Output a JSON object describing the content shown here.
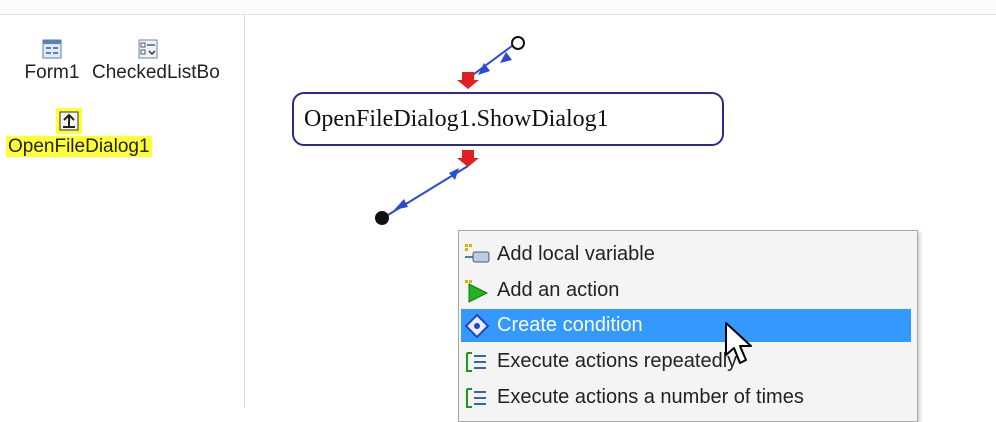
{
  "components": [
    {
      "label": "Form1",
      "icon": "form-icon"
    },
    {
      "label": "CheckedListBo",
      "icon": "checked-list-box-icon"
    },
    {
      "label": "OpenFileDialog1",
      "icon": "open-file-dialog-icon",
      "selected": true
    }
  ],
  "flow": {
    "node_label": "OpenFileDialog1.ShowDialog1"
  },
  "context_menu": {
    "items": [
      {
        "label": "Add local variable",
        "icon": "local-variable-icon"
      },
      {
        "label": "Add an action",
        "icon": "play-arrow-icon"
      },
      {
        "label": "Create condition",
        "icon": "condition-diamond-icon",
        "highlighted": true
      },
      {
        "label": "Execute actions repeatedly",
        "icon": "loop-icon"
      },
      {
        "label": "Execute actions a number of times",
        "icon": "loop-icon"
      }
    ]
  },
  "colors": {
    "highlight": "#3399ff",
    "selection": "#ffff33",
    "node_border": "#2b2b8a",
    "connector": "#2a4bd6",
    "port": "#e02020"
  }
}
